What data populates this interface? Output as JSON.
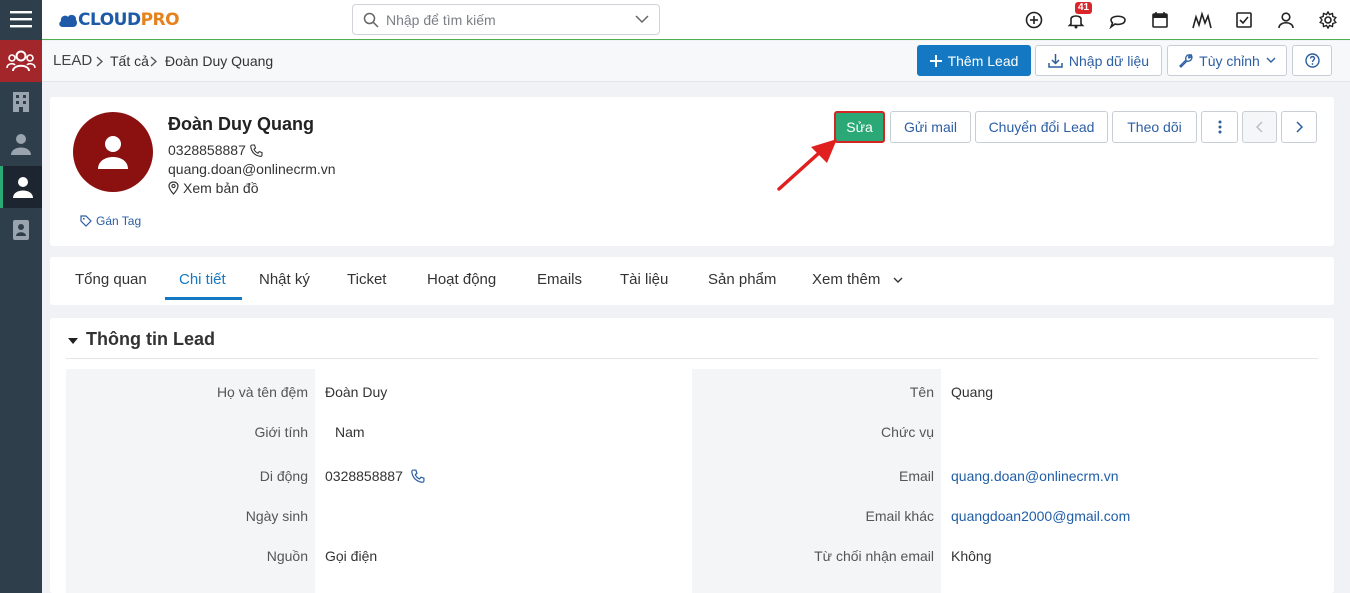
{
  "app": {
    "logo_main": "CLOUD",
    "logo_accent": "PRO"
  },
  "search": {
    "placeholder": "Nhập để tìm kiếm"
  },
  "notifications": {
    "count": "41"
  },
  "breadcrumb": {
    "module": "LEAD",
    "filter": "Tất cả",
    "record": "Đoàn Duy Quang"
  },
  "toolbar": {
    "add_label": "Thêm Lead",
    "import_label": "Nhập dữ liệu",
    "customize_label": "Tùy chỉnh"
  },
  "profile": {
    "name": "Đoàn Duy Quang",
    "phone": "0328858887",
    "email": "quang.doan@onlinecrm.vn",
    "map_label": "Xem bản đồ",
    "tag_label": "Gán Tag",
    "avatar_color": "#8b1010"
  },
  "actions": {
    "edit": "Sửa",
    "send_mail": "Gửi mail",
    "convert": "Chuyển đổi Lead",
    "follow": "Theo dõi"
  },
  "tabs": [
    {
      "label": "Tổng quan"
    },
    {
      "label": "Chi tiết",
      "active": true
    },
    {
      "label": "Nhật ký"
    },
    {
      "label": "Ticket"
    },
    {
      "label": "Hoạt động"
    },
    {
      "label": "Emails"
    },
    {
      "label": "Tài liệu"
    },
    {
      "label": "Sản phẩm"
    },
    {
      "label": "Xem thêm"
    }
  ],
  "section": {
    "title": "Thông tin Lead"
  },
  "fields_left": [
    {
      "label": "Họ và tên đệm",
      "value": "Đoàn Duy"
    },
    {
      "label": "Giới tính",
      "value": "Nam"
    },
    {
      "label": "Di động",
      "value": "0328858887"
    },
    {
      "label": "Ngày sinh",
      "value": ""
    },
    {
      "label": "Nguồn",
      "value": "Gọi điện"
    }
  ],
  "fields_right": [
    {
      "label": "Tên",
      "value": "Quang"
    },
    {
      "label": "Chức vụ",
      "value": ""
    },
    {
      "label": "Email",
      "value": "quang.doan@onlinecrm.vn"
    },
    {
      "label": "Email khác",
      "value": "quangdoan2000@gmail.com"
    },
    {
      "label": "Từ chối nhận email",
      "value": "Không"
    }
  ],
  "colors": {
    "primary": "#1578c2",
    "edit_button": "#2aa876",
    "sidebar": "#2f3e4b",
    "sidebar_active": "#a3262b",
    "highlight_arrow": "#e0201f"
  }
}
